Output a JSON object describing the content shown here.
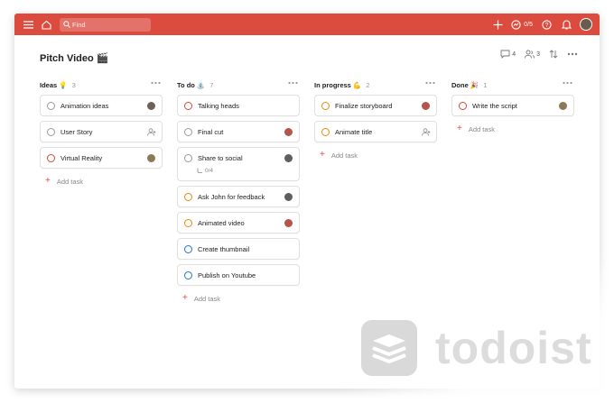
{
  "topbar": {
    "search_placeholder": "Find",
    "karma": "0/5"
  },
  "header": {
    "title": "Pitch Video 🎬",
    "comments_count": "4",
    "members_count": "3"
  },
  "add_task_label": "Add task",
  "columns": [
    {
      "title": "Ideas 💡",
      "count": "3",
      "tasks": [
        {
          "text": "Animation ideas"
        },
        {
          "text": "User Story"
        },
        {
          "text": "Virtual Reality"
        }
      ]
    },
    {
      "title": "To do ⛲",
      "count": "7",
      "tasks": [
        {
          "text": "Talking heads"
        },
        {
          "text": "Final cut"
        },
        {
          "text": "Share to social",
          "sub": "0/4"
        },
        {
          "text": "Ask John for feedback"
        },
        {
          "text": "Animated video"
        },
        {
          "text": "Create thumbnail"
        },
        {
          "text": "Publish on Youtube"
        }
      ]
    },
    {
      "title": "In progress 💪",
      "count": "2",
      "tasks": [
        {
          "text": "Finalize storyboard"
        },
        {
          "text": "Animate title"
        }
      ]
    },
    {
      "title": "Done 🎉",
      "count": "1",
      "tasks": [
        {
          "text": "Write the script"
        }
      ]
    }
  ],
  "brand": {
    "name": "todoist"
  },
  "colors": {
    "accent": "#db4c3f",
    "priority_1": "#d1453b",
    "priority_2": "#eb8909",
    "priority_3": "#246fe0",
    "priority_4": "#999999"
  }
}
